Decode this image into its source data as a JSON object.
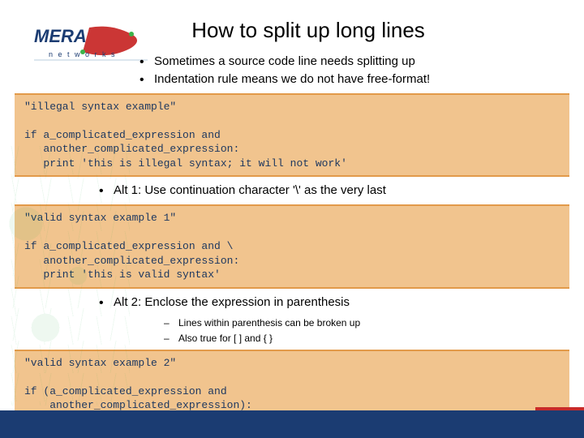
{
  "title": "How to split up long lines",
  "logo": {
    "brand": "MERA",
    "sub": "n e t w o r k s"
  },
  "bullets_intro": [
    "Sometimes a source code line needs splitting up",
    "Indentation rule means we do not have free-format!"
  ],
  "code1": "\"illegal syntax example\"\n\nif a_complicated_expression and\n   another_complicated_expression:\n   print 'this is illegal syntax; it will not work'",
  "bullets_alt1": [
    "Alt 1: Use continuation character '\\' as the very last"
  ],
  "code2": "\"valid syntax example 1\"\n\nif a_complicated_expression and \\\n   another_complicated_expression:\n   print 'this is valid syntax'",
  "bullets_alt2": [
    "Alt 2: Enclose the expression in parenthesis"
  ],
  "bullets_alt2_sub": [
    "Lines within parenthesis can be broken up",
    "Also true for [ ] and { }"
  ],
  "code3": "\"valid syntax example 2\"\n\nif (a_complicated_expression and\n    another_complicated_expression):\n   print 'this is valid syntax'"
}
